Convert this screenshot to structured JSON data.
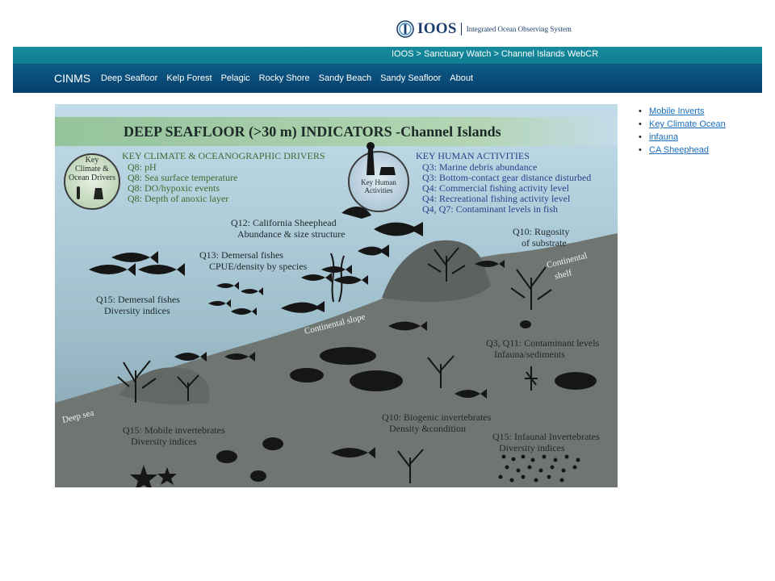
{
  "logo": {
    "name": "IOOS",
    "tagline": "Integrated Ocean Observing System"
  },
  "breadcrumb": "IOOS > Sanctuary Watch > Channel Islands WebCR",
  "nav": {
    "brand": "CINMS",
    "links": [
      "Deep Seafloor",
      "Kelp Forest",
      "Pelagic",
      "Rocky Shore",
      "Sandy Beach",
      "Sandy Seafloor",
      "About"
    ]
  },
  "sidebar": {
    "items": [
      "Mobile Inverts",
      "Key Climate Ocean",
      "infauna",
      "CA Sheephead"
    ]
  },
  "scene": {
    "title": "DEEP SEAFLOOR (>30 m) INDICATORS -Channel Islands",
    "climate_badge": [
      "Key",
      "Climate &",
      "Ocean Drivers"
    ],
    "climate_heading": "KEY CLIMATE & OCEANOGRAPHIC DRIVERS",
    "climate_items": [
      "Q8: pH",
      "Q8: Sea surface temperature",
      "Q8: DO/hypoxic events",
      "Q8: Depth of anoxic layer"
    ],
    "human_badge": [
      "Key Human",
      "Activities"
    ],
    "human_heading": "KEY HUMAN ACTIVITIES",
    "human_items": [
      "Q3: Marine debris abundance",
      "Q3: Bottom-contact gear distance disturbed",
      "Q4: Commercial fishing activity level",
      "Q4: Recreational fishing activity level",
      "Q4, Q7: Contaminant levels in fish"
    ],
    "q12": [
      "Q12: California Sheephead",
      "Abundance & size structure"
    ],
    "q10a": [
      "Q10: Rugosity",
      "of substrate"
    ],
    "q13": [
      "Q13: Demersal fishes",
      "CPUE/density by species"
    ],
    "q15a": [
      "Q15: Demersal fishes",
      "Diversity indices"
    ],
    "continental_slope": "Continental slope",
    "continental_shelf": [
      "Continental",
      "shelf"
    ],
    "q3q11": [
      "Q3, Q11: Contaminant levels",
      "Infauna/sediments"
    ],
    "deep_sea": "Deep sea",
    "q15b": [
      "Q15: Mobile invertebrates",
      "Diversity indices"
    ],
    "q10b": [
      "Q10: Biogenic invertebrates",
      "Density &condition"
    ],
    "q15c": [
      "Q15: Infaunal Invertebrates",
      "Diversity indices"
    ],
    "colors": {
      "water_top": "#bcd8e6",
      "water_bottom": "#8aa8b6",
      "seafloor": "#6f7571",
      "seafloor_dark": "#5c625f",
      "title_band": "#9ec9a3",
      "green_text": "#3d6b2f",
      "navy_text": "#2c3e8c",
      "silhouette": "#161616"
    }
  }
}
